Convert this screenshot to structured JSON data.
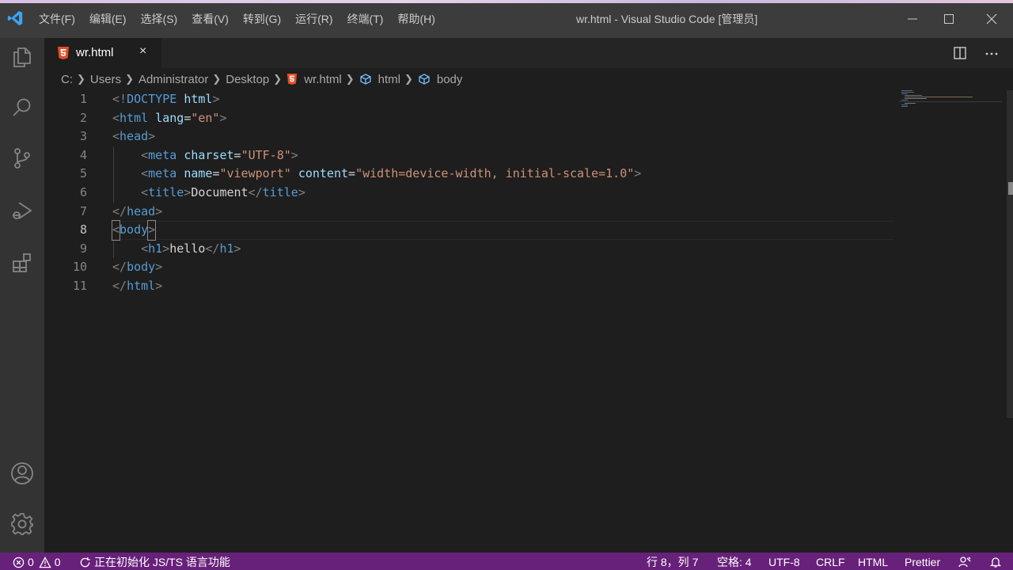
{
  "titlebar": {
    "menu": [
      "文件(F)",
      "编辑(E)",
      "选择(S)",
      "查看(V)",
      "转到(G)",
      "运行(R)",
      "终端(T)",
      "帮助(H)"
    ],
    "window_title": "wr.html - Visual Studio Code [管理员]"
  },
  "activity_bar": {
    "top_icons": [
      "files-icon",
      "search-icon",
      "source-control-icon",
      "run-debug-icon",
      "extensions-icon"
    ],
    "bottom_icons": [
      "accounts-icon",
      "settings-gear-icon"
    ]
  },
  "tab": {
    "label": "wr.html",
    "close": "×"
  },
  "breadcrumb": [
    "C:",
    "Users",
    "Administrator",
    "Desktop",
    "wr.html",
    "html",
    "body"
  ],
  "editor": {
    "line_numbers": [
      "1",
      "2",
      "3",
      "4",
      "5",
      "6",
      "7",
      "8",
      "9",
      "10",
      "11"
    ],
    "active_line": "8"
  },
  "status": {
    "errors": "0",
    "warnings": "0",
    "progress": "正在初始化 JS/TS 语言功能",
    "position": "行 8，列 7",
    "spaces": "空格: 4",
    "encoding": "UTF-8",
    "eol": "CRLF",
    "language": "HTML",
    "formatter": "Prettier"
  },
  "colors": {
    "statusbar": "#68217a",
    "tag": "#569cd6",
    "attribute": "#9cdcfe",
    "string": "#ce9178",
    "html_icon": "#e44d26"
  }
}
